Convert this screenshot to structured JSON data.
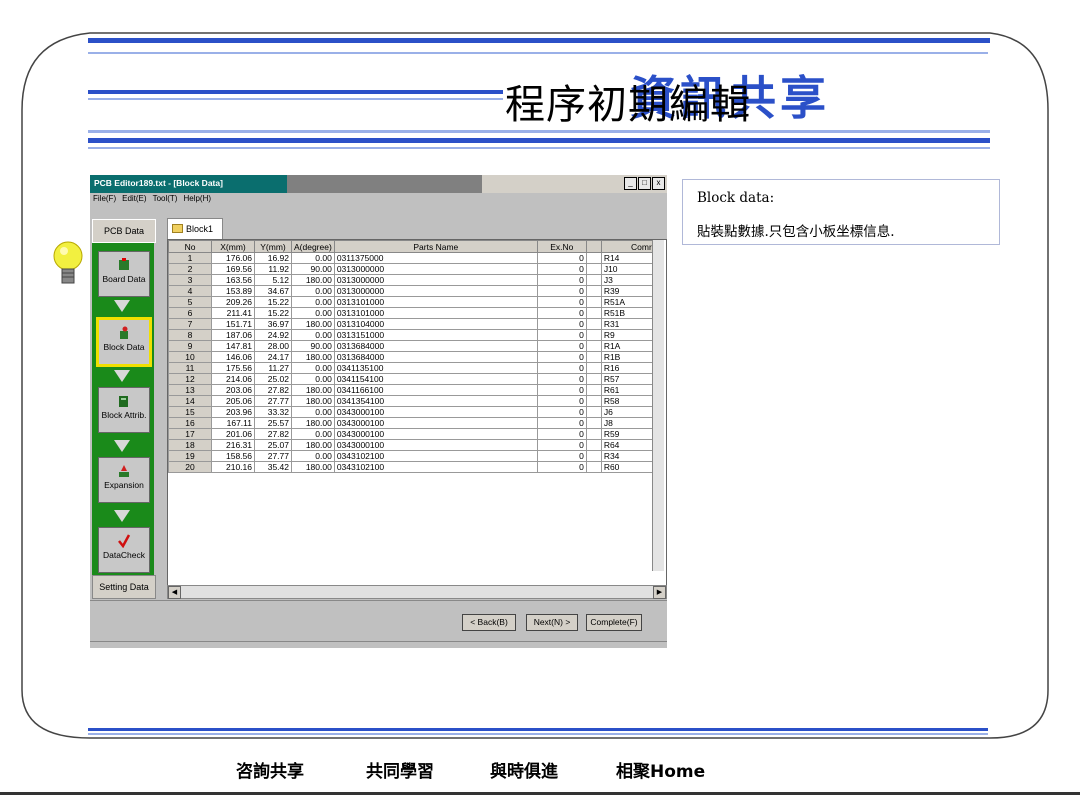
{
  "slide": {
    "title": "程序初期編輯",
    "title_background": "資訊共享",
    "accent_color": "#2b50c8"
  },
  "window": {
    "title": "PCB Editor189.txt - [Block Data]",
    "menu": [
      "File(F)",
      "Edit(E)",
      "Tool(T)",
      "Help(H)"
    ],
    "controls": [
      "_",
      "□",
      "x"
    ],
    "pcb_data_tab": "PCB Data",
    "block_tab": "Block1",
    "sidebar": [
      {
        "label": "Board Data",
        "icon": "board-icon"
      },
      {
        "label": "Block Data",
        "icon": "block-icon",
        "selected": true
      },
      {
        "label": "Block Attrib.",
        "icon": "attrib-icon"
      },
      {
        "label": "Expansion",
        "icon": "expansion-icon"
      },
      {
        "label": "DataCheck",
        "icon": "check-icon"
      }
    ],
    "setting_data": "Setting Data",
    "buttons": {
      "back": "< Back(B)",
      "next": "Next(N) >",
      "complete": "Complete(F)"
    }
  },
  "table": {
    "headers": [
      "No",
      "X(mm)",
      "Y(mm)",
      "A(degree)",
      "Parts Name",
      "Ex.No",
      "",
      "Comr"
    ],
    "rows": [
      [
        "1",
        "176.06",
        "16.92",
        "0.00",
        "0311375000",
        "0",
        "R14"
      ],
      [
        "2",
        "169.56",
        "11.92",
        "90.00",
        "0313000000",
        "0",
        "J10"
      ],
      [
        "3",
        "163.56",
        "5.12",
        "180.00",
        "0313000000",
        "0",
        "J3"
      ],
      [
        "4",
        "153.89",
        "34.67",
        "0.00",
        "0313000000",
        "0",
        "R39"
      ],
      [
        "5",
        "209.26",
        "15.22",
        "0.00",
        "0313101000",
        "0",
        "R51A"
      ],
      [
        "6",
        "211.41",
        "15.22",
        "0.00",
        "0313101000",
        "0",
        "R51B"
      ],
      [
        "7",
        "151.71",
        "36.97",
        "180.00",
        "0313104000",
        "0",
        "R31"
      ],
      [
        "8",
        "187.06",
        "24.92",
        "0.00",
        "0313151000",
        "0",
        "R9"
      ],
      [
        "9",
        "147.81",
        "28.00",
        "90.00",
        "0313684000",
        "0",
        "R1A"
      ],
      [
        "10",
        "146.06",
        "24.17",
        "180.00",
        "0313684000",
        "0",
        "R1B"
      ],
      [
        "11",
        "175.56",
        "11.27",
        "0.00",
        "0341135100",
        "0",
        "R16"
      ],
      [
        "12",
        "214.06",
        "25.02",
        "0.00",
        "0341154100",
        "0",
        "R57"
      ],
      [
        "13",
        "203.06",
        "27.82",
        "180.00",
        "0341166100",
        "0",
        "R61"
      ],
      [
        "14",
        "205.06",
        "27.77",
        "180.00",
        "0341354100",
        "0",
        "R58"
      ],
      [
        "15",
        "203.96",
        "33.32",
        "0.00",
        "0343000100",
        "0",
        "J6"
      ],
      [
        "16",
        "167.11",
        "25.57",
        "180.00",
        "0343000100",
        "0",
        "J8"
      ],
      [
        "17",
        "201.06",
        "27.82",
        "0.00",
        "0343000100",
        "0",
        "R59"
      ],
      [
        "18",
        "216.31",
        "25.07",
        "180.00",
        "0343000100",
        "0",
        "R64"
      ],
      [
        "19",
        "158.56",
        "27.77",
        "0.00",
        "0343102100",
        "0",
        "R34"
      ],
      [
        "20",
        "210.16",
        "35.42",
        "180.00",
        "0343102100",
        "0",
        "R60"
      ]
    ]
  },
  "info": {
    "heading": "Block data:",
    "text": "貼裝點數據.只包含小板坐標信息."
  },
  "footer": [
    "咨詢共享",
    "共同學習",
    "與時俱進",
    "相聚Home"
  ]
}
